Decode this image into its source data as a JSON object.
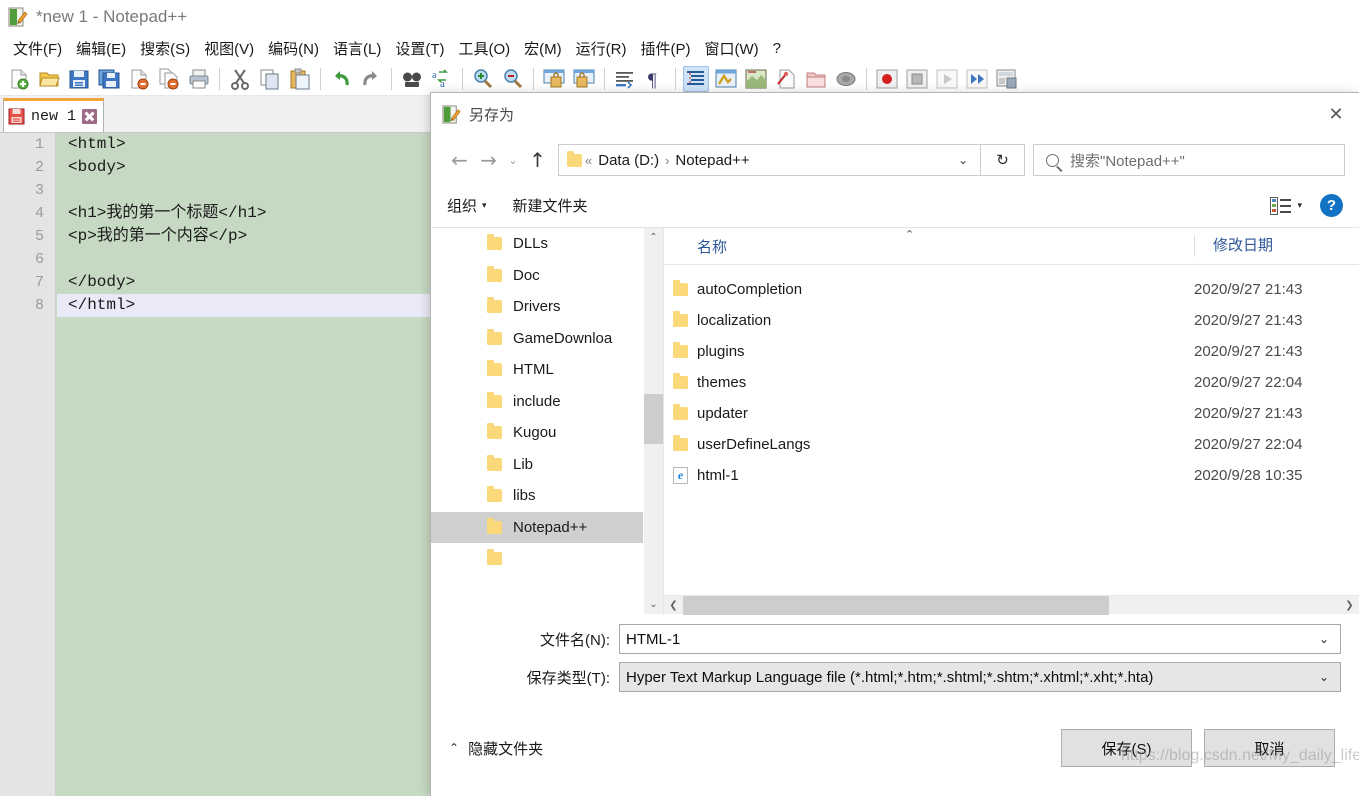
{
  "app": {
    "title": "*new 1 - Notepad++",
    "icon": "notepadpp-icon",
    "menu": [
      {
        "label": "文件(F)",
        "name": "menu-file"
      },
      {
        "label": "编辑(E)",
        "name": "menu-edit"
      },
      {
        "label": "搜索(S)",
        "name": "menu-search"
      },
      {
        "label": "视图(V)",
        "name": "menu-view"
      },
      {
        "label": "编码(N)",
        "name": "menu-encoding"
      },
      {
        "label": "语言(L)",
        "name": "menu-language"
      },
      {
        "label": "设置(T)",
        "name": "menu-settings"
      },
      {
        "label": "工具(O)",
        "name": "menu-tools"
      },
      {
        "label": "宏(M)",
        "name": "menu-macro"
      },
      {
        "label": "运行(R)",
        "name": "menu-run"
      },
      {
        "label": "插件(P)",
        "name": "menu-plugins"
      },
      {
        "label": "窗口(W)",
        "name": "menu-window"
      },
      {
        "label": "?",
        "name": "menu-help"
      }
    ],
    "toolbar_icons": [
      "new-file-icon",
      "open-file-icon",
      "save-icon",
      "save-all-icon",
      "close-file-icon",
      "close-all-icon",
      "print-icon",
      "sep",
      "cut-icon",
      "copy-icon",
      "paste-icon",
      "sep",
      "undo-icon",
      "redo-icon",
      "sep",
      "find-icon",
      "replace-icon",
      "sep",
      "zoom-in-icon",
      "zoom-out-icon",
      "sep",
      "sync-vertical-icon",
      "sync-horizontal-icon",
      "sep",
      "word-wrap-icon",
      "show-all-chars-icon",
      "sep",
      "indent-guide-icon",
      "user-define-dialog-icon",
      "doc-map-icon",
      "function-list-icon",
      "folder-as-workspace-icon",
      "monitoring-icon",
      "sep",
      "record-macro-icon",
      "stop-record-icon",
      "playback-icon",
      "run-macro-multiple-icon",
      "save-macro-icon"
    ],
    "tab": {
      "label": "new 1",
      "save_icon": "unsaved-floppy-icon",
      "close_icon": "tab-close-icon"
    },
    "editor": {
      "line_numbers": [
        "1",
        "2",
        "3",
        "4",
        "5",
        "6",
        "7",
        "8"
      ],
      "lines": [
        "<html>",
        "<body>",
        "",
        "<h1>我的第一个标题</h1>",
        "<p>我的第一个内容</p>",
        "",
        "</body>",
        "</html>"
      ],
      "current_line_index": 7,
      "bg_color": "#c6d9c2",
      "gutter_color": "#e4e4e4",
      "current_line_color": "#e9e9f7"
    }
  },
  "dialog": {
    "title": "另存为",
    "title_icon": "notepadpp-icon",
    "close_label": "✕",
    "nav": {
      "back_icon": "arrow-left-icon",
      "forward_icon": "arrow-right-icon",
      "recent_icon": "chevron-down-icon",
      "up_icon": "arrow-up-icon",
      "folder_icon": "folder-icon",
      "crumb_prefix": "«",
      "crumb_drive": "Data (D:)",
      "crumb_sep": "›",
      "crumb_current": "Notepad++",
      "dropdown_icon": "chevron-down-icon",
      "refresh_icon": "refresh-icon",
      "refresh_glyph": "↻",
      "search_icon": "search-icon",
      "search_placeholder": "搜索\"Notepad++\""
    },
    "commandbar": {
      "organize": "组织",
      "new_folder": "新建文件夹",
      "view_mode_icon": "view-mode-icon",
      "view_caret": "▾",
      "help_icon": "help-icon",
      "help_glyph": "?"
    },
    "tree": {
      "items": [
        {
          "label": "DLLs",
          "selected": false
        },
        {
          "label": "Doc",
          "selected": false
        },
        {
          "label": "Drivers",
          "selected": false
        },
        {
          "label": "GameDownloa",
          "selected": false
        },
        {
          "label": "HTML",
          "selected": false
        },
        {
          "label": "include",
          "selected": false
        },
        {
          "label": "Kugou",
          "selected": false
        },
        {
          "label": "Lib",
          "selected": false
        },
        {
          "label": "libs",
          "selected": false
        },
        {
          "label": "Notepad++",
          "selected": true
        }
      ],
      "scroll_up_glyph": "⌃",
      "scroll_down_glyph": "⌄"
    },
    "filelist": {
      "columns": [
        "名称",
        "修改日期"
      ],
      "sort_caret": "⌃",
      "rows": [
        {
          "name": "autoCompletion",
          "date": "2020/9/27 21:43",
          "icon": "folder-icon"
        },
        {
          "name": "localization",
          "date": "2020/9/27 21:43",
          "icon": "folder-icon"
        },
        {
          "name": "plugins",
          "date": "2020/9/27 21:43",
          "icon": "folder-icon"
        },
        {
          "name": "themes",
          "date": "2020/9/27 22:04",
          "icon": "folder-icon"
        },
        {
          "name": "updater",
          "date": "2020/9/27 21:43",
          "icon": "folder-icon"
        },
        {
          "name": "userDefineLangs",
          "date": "2020/9/27 22:04",
          "icon": "folder-icon"
        },
        {
          "name": "html-1",
          "date": "2020/9/28 10:35",
          "icon": "ie-html-file-icon"
        }
      ],
      "hscroll_left_glyph": "❮",
      "hscroll_right_glyph": "❯"
    },
    "form": {
      "filename_label": "文件名(N):",
      "filename_value": "HTML-1",
      "filetype_label": "保存类型(T):",
      "filetype_value": "Hyper Text Markup Language file (*.html;*.htm;*.shtml;*.shtm;*.xhtml;*.xht;*.hta)",
      "caret": "⌄"
    },
    "footer": {
      "hide_folders_caret": "⌃",
      "hide_folders_label": "隐藏文件夹",
      "save_label": "保存(S)",
      "cancel_label": "取消"
    }
  },
  "watermark": "https://blog.csdn.net/My_daily_life"
}
